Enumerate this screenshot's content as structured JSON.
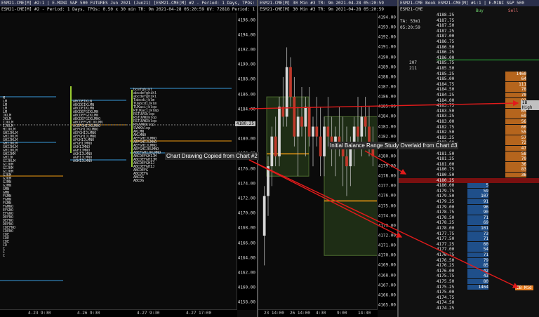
{
  "pane1": {
    "title": "ESM21-CME[M] #2:1 | E-MINI S&P 500 FUTURES Jun 2021 (Jun21) [ESM21-CME[M] #2 - Period: 1 Days, TPOs: 0.50 x 30 min",
    "info": "ESM21-CME[M] #2 - Period: 1 Days, TPOs: 0.50 x 30 min   TR: 9m 2021-04-28 05:20:59  OV: 72818  Period: 1 Da",
    "price_flag": "4180.25",
    "x_labels": [
      "4-23 9:30",
      "4-26 9:30",
      "4-27 9:30",
      "4-27 17:00"
    ],
    "y_labels": [
      "4196.00",
      "4194.00",
      "4192.00",
      "4190.00",
      "4188.00",
      "4186.00",
      "4184.00",
      "4182.00",
      "4180.00",
      "4178.00",
      "4176.00",
      "4174.00",
      "4172.00",
      "4170.00",
      "4168.00",
      "4166.00",
      "4164.00",
      "4162.00",
      "4160.00",
      "4158.00"
    ],
    "profiles": [
      "M\nLM\nLM\nLM\nLM\nJKLM\nJKLM\nIJKLM\nIJKLM\nHIJKLM\nGHIJKLM\nGHIJKLM\nGHIJKLM\nGHIJKLM\nGHIJKLM\nGHIJKLM\nGHIJKM\nGHIJK\nGIJKLM\nGIJKM\nGIJKM\nGIJKM\nGJKM\nGJKM\nGJMN\nGJMN\nGMN\nGMN\nFGMN\nFGMN\nFGMN\nFGMNO\nEFGNO\nEFGNO\nDEFNO\nDEFNO\nDEFNO\nCDEFNO\nCDENO\nCDE\nCDE\nCDE\nCD\nC\nC\nC",
      "ABCDEIKLN\nABCDEIKLMN\nABCDEIKLMN\nABCDEFGIKLMN\nABCDEFGIKLMN\nABCDEFGIKLMNO\nABCDEFGHIJKLMN\nACEFGHIJKLMNO\nAEFGHIJKLMNO\nAEFGHIJLMNO\nAEFGHIJLMNO\nAFGHIJLMNO\nAFGHIJMNO\nAGHIJMNO\nAGHIJMNO\nAGHIJLMNO\nAGHIJLMNO\nAGHIJLMNO",
      "bcefghikl\nabcdefghikl\nabcdefghikl\nTabcdijklm\nTUabcdiJklm\nTUXacijklop\nRTUXacijklmp\nRSTUVXklop\nRSTUVWXklop\nRSTUVWXklop\nRSUVWXklop\nSVWXklop\nAKLMN\nAKLMNO\nAEFGHIJLMNO\nAEFGHIJLMNO\nAEFGHIJLMNO\nAEFGHIJKLMNO\nABEFGHIJKLMNO\nABCDEFGHIJM\nABCDEFGHIJM\nABCDEFGHIJ\nABCDEFGHIJ\nABCDEFG\nABCDEFG\nABCDG\nABCDG"
    ]
  },
  "pane2": {
    "title": "ESM21-CME[M] 30 Min #3 TR: 9m 2021-04-28 05:20:59",
    "info": "ESM21-CME[M] 30 Min #3 TR: 9m 2021-04-28 05:20:59",
    "annotation_copied": "Chart Drawing Copied from Chart #2",
    "annotation_ib": "Initial Balance Range Study Overlaid from Chart #3",
    "x_labels": [
      "23 14:00",
      "26 14:00",
      "4:30",
      "9:00",
      "14:30"
    ],
    "y_labels": [
      "4194.00",
      "4193.00",
      "4192.00",
      "4191.00",
      "4190.00",
      "4189.00",
      "4188.00",
      "4187.00",
      "4186.00",
      "4185.00",
      "4184.00",
      "4183.00",
      "4182.00",
      "4181.00",
      "4180.00",
      "4179.00",
      "4178.00",
      "4177.00",
      "4176.00",
      "4175.00",
      "4174.00",
      "4173.00",
      "4172.00",
      "4171.00",
      "4170.00",
      "4169.00",
      "4168.00",
      "4167.00",
      "4166.00",
      "4165.00"
    ],
    "candles": [
      [
        4172,
        4177,
        4169,
        4176
      ],
      [
        4176,
        4180,
        4174,
        4179
      ],
      [
        4179,
        4183,
        4177,
        4182
      ],
      [
        4182,
        4184,
        4179,
        4180
      ],
      [
        4180,
        4186,
        4179,
        4185
      ],
      [
        4185,
        4188,
        4183,
        4184
      ],
      [
        4184,
        4191,
        4183,
        4189
      ],
      [
        4189,
        4190,
        4185,
        4186
      ],
      [
        4186,
        4188,
        4181,
        4182
      ],
      [
        4182,
        4185,
        4178,
        4184
      ],
      [
        4184,
        4187,
        4182,
        4183
      ],
      [
        4183,
        4186,
        4180,
        4185
      ],
      [
        4185,
        4187,
        4181,
        4182
      ],
      [
        4182,
        4184,
        4179,
        4183
      ],
      [
        4183,
        4186,
        4181,
        4182
      ],
      [
        4182,
        4185,
        4178,
        4180
      ],
      [
        4180,
        4184,
        4178,
        4183
      ],
      [
        4183,
        4186,
        4181,
        4182
      ],
      [
        4182,
        4184,
        4179,
        4181
      ],
      [
        4181,
        4183,
        4178,
        4182
      ],
      [
        4182,
        4185,
        4180,
        4181
      ],
      [
        4181,
        4184,
        4177,
        4180
      ],
      [
        4180,
        4183,
        4176,
        4179
      ],
      [
        4179,
        4182,
        4177,
        4181
      ],
      [
        4181,
        4184,
        4179,
        4183
      ],
      [
        4183,
        4186,
        4181,
        4182
      ],
      [
        4182,
        4185,
        4180,
        4184
      ],
      [
        4184,
        4186,
        4182,
        4183
      ],
      [
        4183,
        4185,
        4180,
        4181
      ],
      [
        4181,
        4183,
        4179,
        4180
      ]
    ]
  },
  "pane3": {
    "title": "ESM21-CME Book ESM21-CME[M] #1:1 | E-MINI S&P 500",
    "header_symbol": "ESM21-CME",
    "header_ta": "TA: 53m1",
    "header_time": "05:20:59",
    "col_buy": "Buy",
    "col_sell": "Sell",
    "highlight_price": "4180.25",
    "last_label": "1",
    "high_tag": "IB High",
    "mid_tag": "IB Mid",
    "rows": [
      {
        "p": "4188.25",
        "b": "",
        "s": "",
        "v": ""
      },
      {
        "p": "4187.75",
        "b": "",
        "s": "",
        "v": ""
      },
      {
        "p": "4187.50",
        "b": "",
        "s": "",
        "v": ""
      },
      {
        "p": "4187.25",
        "b": "",
        "s": "",
        "v": ""
      },
      {
        "p": "4187.00",
        "b": "",
        "s": "",
        "v": ""
      },
      {
        "p": "4186.75",
        "b": "",
        "s": "",
        "v": ""
      },
      {
        "p": "4186.50",
        "b": "",
        "s": "",
        "v": ""
      },
      {
        "p": "4186.25",
        "b": "",
        "s": "",
        "v": ""
      },
      {
        "p": "4186.00",
        "b": "",
        "s": "",
        "v": ""
      },
      {
        "p": "4185.75",
        "b": "",
        "s": "",
        "v": "207"
      },
      {
        "p": "4185.50",
        "b": "",
        "s": "",
        "v": "211"
      },
      {
        "p": "4185.25",
        "b": "",
        "s": "1460",
        "v": ""
      },
      {
        "p": "4185.00",
        "b": "",
        "s": "64",
        "v": ""
      },
      {
        "p": "4184.75",
        "b": "",
        "s": "111",
        "v": ""
      },
      {
        "p": "4184.50",
        "b": "",
        "s": "78",
        "v": ""
      },
      {
        "p": "4184.25",
        "b": "",
        "s": "70",
        "v": ""
      },
      {
        "p": "4184.00",
        "b": "",
        "s": "92",
        "v": ""
      },
      {
        "p": "4183.75",
        "b": "",
        "s": "83",
        "v": ""
      },
      {
        "p": "4183.50",
        "b": "",
        "s": "65",
        "v": ""
      },
      {
        "p": "4183.25",
        "b": "",
        "s": "69",
        "v": ""
      },
      {
        "p": "4183.00",
        "b": "",
        "s": "56",
        "v": ""
      },
      {
        "p": "4182.75",
        "b": "",
        "s": "66",
        "v": ""
      },
      {
        "p": "4182.50",
        "b": "",
        "s": "55",
        "v": ""
      },
      {
        "p": "4182.25",
        "b": "",
        "s": "57",
        "v": ""
      },
      {
        "p": "4182.00",
        "b": "",
        "s": "72",
        "v": ""
      },
      {
        "p": "4181.75",
        "b": "",
        "s": "47",
        "v": ""
      },
      {
        "p": "4181.50",
        "b": "",
        "s": "58",
        "v": ""
      },
      {
        "p": "4181.25",
        "b": "",
        "s": "70",
        "v": ""
      },
      {
        "p": "4181.00",
        "b": "",
        "s": "36",
        "v": ""
      },
      {
        "p": "4180.75",
        "b": "",
        "s": "83",
        "v": ""
      },
      {
        "p": "4180.50",
        "b": "",
        "s": "36",
        "v": ""
      },
      {
        "p": "4180.25",
        "b": "",
        "s": "",
        "v": ""
      },
      {
        "p": "4180.00",
        "b": "5",
        "s": "",
        "v": ""
      },
      {
        "p": "4179.75",
        "b": "59",
        "s": "",
        "v": ""
      },
      {
        "p": "4179.50",
        "b": "107",
        "s": "",
        "v": ""
      },
      {
        "p": "4179.25",
        "b": "91",
        "s": "",
        "v": ""
      },
      {
        "p": "4179.00",
        "b": "96",
        "s": "",
        "v": ""
      },
      {
        "p": "4178.75",
        "b": "90",
        "s": "",
        "v": ""
      },
      {
        "p": "4178.50",
        "b": "71",
        "s": "",
        "v": ""
      },
      {
        "p": "4178.25",
        "b": "69",
        "s": "",
        "v": ""
      },
      {
        "p": "4178.00",
        "b": "101",
        "s": "",
        "v": ""
      },
      {
        "p": "4177.75",
        "b": "73",
        "s": "",
        "v": ""
      },
      {
        "p": "4177.50",
        "b": "71",
        "s": "",
        "v": ""
      },
      {
        "p": "4177.25",
        "b": "60",
        "s": "",
        "v": ""
      },
      {
        "p": "4177.00",
        "b": "54",
        "s": "",
        "v": ""
      },
      {
        "p": "4176.75",
        "b": "71",
        "s": "",
        "v": ""
      },
      {
        "p": "4176.50",
        "b": "79",
        "s": "",
        "v": ""
      },
      {
        "p": "4176.25",
        "b": "85",
        "s": "",
        "v": ""
      },
      {
        "p": "4176.00",
        "b": "42",
        "s": "",
        "v": ""
      },
      {
        "p": "4175.75",
        "b": "43",
        "s": "",
        "v": ""
      },
      {
        "p": "4175.50",
        "b": "80",
        "s": "",
        "v": ""
      },
      {
        "p": "4175.25",
        "b": "1464",
        "s": "",
        "v": ""
      },
      {
        "p": "4175.00",
        "b": "",
        "s": "",
        "v": ""
      },
      {
        "p": "4174.75",
        "b": "",
        "s": "",
        "v": ""
      },
      {
        "p": "4174.50",
        "b": "",
        "s": "",
        "v": ""
      },
      {
        "p": "4174.25",
        "b": "",
        "s": "",
        "v": ""
      }
    ]
  }
}
